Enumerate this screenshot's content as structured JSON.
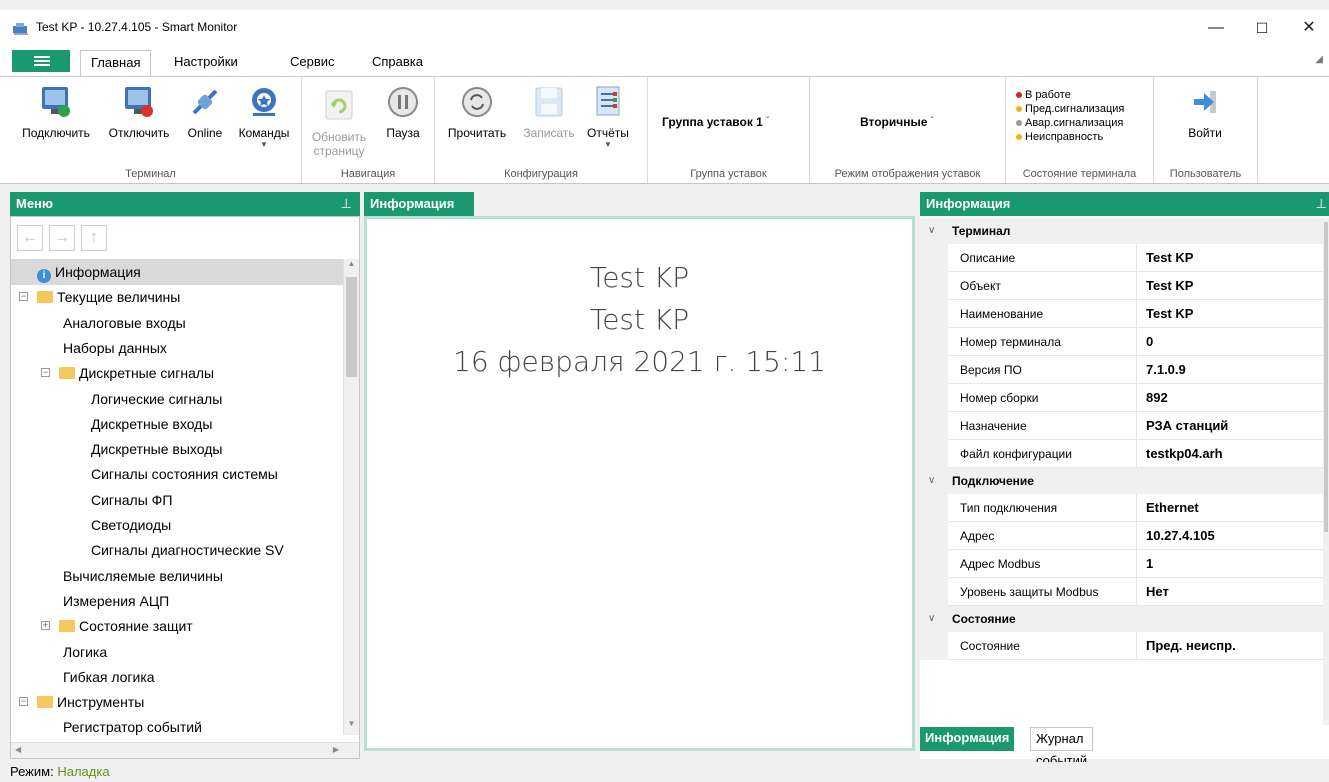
{
  "window": {
    "title": "Test KP - 10.27.4.105 - Smart Monitor",
    "minimize": "—",
    "maximize": "☐",
    "close": "✕"
  },
  "ribbon_tabs": [
    {
      "label": "Главная",
      "active": true
    },
    {
      "label": "Настройки",
      "active": false
    },
    {
      "label": "Сервис",
      "active": false
    },
    {
      "label": "Справка",
      "active": false
    }
  ],
  "ribbon": {
    "terminal": {
      "group_label": "Терминал",
      "connect": "Подключить",
      "disconnect": "Отключить",
      "online": "Online",
      "commands": "Команды"
    },
    "navigation": {
      "group_label": "Навигация",
      "refresh_line1": "Обновить",
      "refresh_line2": "страницу",
      "pause": "Пауза"
    },
    "configuration": {
      "group_label": "Конфигурация",
      "read": "Прочитать",
      "write": "Записать",
      "reports": "Отчёты"
    },
    "setting_group": {
      "group_label": "Группа уставок",
      "value": "Группа уставок 1"
    },
    "display_mode": {
      "group_label": "Режим отображения уставок",
      "value": "Вторичные"
    },
    "terminal_state": {
      "group_label": "Состояние терминала",
      "items": [
        {
          "label": "В работе",
          "color": "#e02020"
        },
        {
          "label": "Пред.сигнализация",
          "color": "#f2b01e"
        },
        {
          "label": "Авар.сигнализация",
          "color": "#9a9a9a"
        },
        {
          "label": "Неисправность",
          "color": "#f2b01e"
        }
      ]
    },
    "user": {
      "group_label": "Пользователь",
      "login": "Войти"
    }
  },
  "left_panel": {
    "title": "Меню",
    "pin": "⊥",
    "tree": [
      {
        "label": "Информация",
        "level": 0,
        "icon": "info-icon",
        "selected": true
      },
      {
        "label": "Текущие величины",
        "level": 0,
        "icon": "folder-icon",
        "expander": "−"
      },
      {
        "label": "Аналоговые входы",
        "level": 1
      },
      {
        "label": "Наборы данных",
        "level": 1
      },
      {
        "label": "Дискретные сигналы",
        "level": 1,
        "icon": "folder-icon",
        "expander": "−"
      },
      {
        "label": "Логические сигналы",
        "level": 2
      },
      {
        "label": "Дискретные входы",
        "level": 2
      },
      {
        "label": "Дискретные выходы",
        "level": 2
      },
      {
        "label": "Сигналы состояния системы",
        "level": 2
      },
      {
        "label": "Сигналы ФП",
        "level": 2
      },
      {
        "label": "Светодиоды",
        "level": 2
      },
      {
        "label": "Сигналы диагностические SV",
        "level": 2
      },
      {
        "label": "Вычисляемые величины",
        "level": 1
      },
      {
        "label": "Измерения АЦП",
        "level": 1
      },
      {
        "label": "Состояние защит",
        "level": 1,
        "icon": "folder-icon",
        "expander": "+"
      },
      {
        "label": "Логика",
        "level": 1
      },
      {
        "label": "Гибкая логика",
        "level": 1
      },
      {
        "label": "Инструменты",
        "level": 0,
        "icon": "folder-icon",
        "expander": "−"
      },
      {
        "label": "Регистратор событий",
        "level": 1
      }
    ]
  },
  "center_panel": {
    "tab": "Информация",
    "line1": "Test KP",
    "line2": "Test KP",
    "line3": "16 февраля 2021 г. 15:11"
  },
  "right_panel": {
    "title": "Информация",
    "pin": "⊥",
    "categories": [
      {
        "name": "Терминал",
        "rows": [
          {
            "name": "Описание",
            "value": "Test KP"
          },
          {
            "name": "Объект",
            "value": "Test KP"
          },
          {
            "name": "Наименование",
            "value": "Test KP"
          },
          {
            "name": "Номер терминала",
            "value": "0"
          },
          {
            "name": "Версия ПО",
            "value": "7.1.0.9"
          },
          {
            "name": "Номер сборки",
            "value": "892"
          },
          {
            "name": "Назначение",
            "value": "РЗА станций"
          },
          {
            "name": "Файл конфигурации",
            "value": "testkp04.arh"
          }
        ]
      },
      {
        "name": "Подключение",
        "rows": [
          {
            "name": "Тип подключения",
            "value": "Ethernet"
          },
          {
            "name": "Адрес",
            "value": "10.27.4.105"
          },
          {
            "name": "Адрес Modbus",
            "value": "1"
          },
          {
            "name": "Уровень защиты Modbus",
            "value": "Нет"
          }
        ]
      },
      {
        "name": "Состояние",
        "rows": [
          {
            "name": "Состояние",
            "value": "Пред. неиспр."
          }
        ]
      }
    ],
    "bottom_tabs": [
      "Информация",
      "Журнал событий"
    ]
  },
  "statusbar": {
    "label": "Режим:",
    "mode": "Наладка"
  },
  "colors": {
    "accent": "#1a9870",
    "mode_text": "#6a8f1f"
  }
}
